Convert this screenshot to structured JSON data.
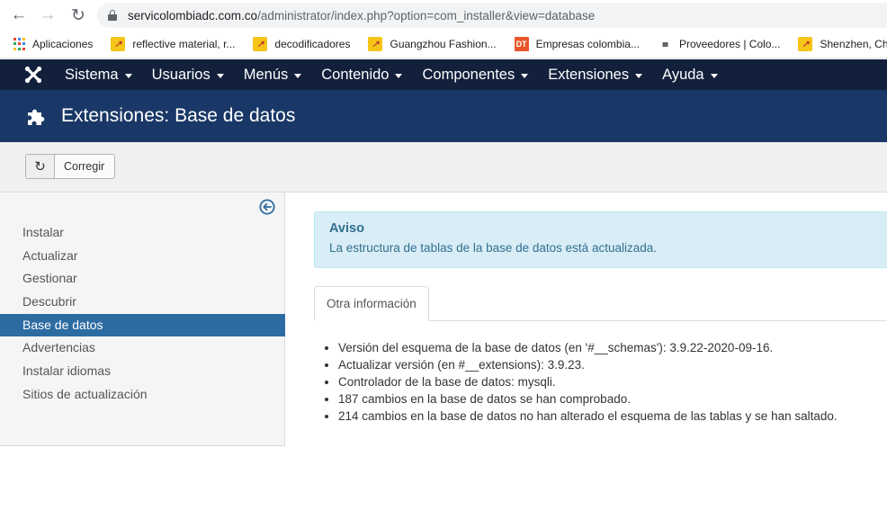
{
  "browser": {
    "url_host": "servicolombiadc.com.co",
    "url_path": "/administrator/index.php?option=com_installer&view=database",
    "bookmarks": [
      {
        "label": "Aplicaciones",
        "icon": "apps-grid-icon"
      },
      {
        "label": "reflective material, r...",
        "icon": "aliexpress-icon"
      },
      {
        "label": "decodificadores",
        "icon": "aliexpress-icon"
      },
      {
        "label": "Guangzhou Fashion...",
        "icon": "aliexpress-icon"
      },
      {
        "label": "Empresas colombia...",
        "icon": "dt-icon",
        "icon_text": "DT"
      },
      {
        "label": "Proveedores | Colo...",
        "icon": "proveedores-icon",
        "icon_text": "ıııı"
      },
      {
        "label": "Shenzhen, China N",
        "icon": "aliexpress-icon"
      }
    ]
  },
  "topnav": {
    "items": [
      {
        "label": "Sistema"
      },
      {
        "label": "Usuarios"
      },
      {
        "label": "Menús"
      },
      {
        "label": "Contenido"
      },
      {
        "label": "Componentes"
      },
      {
        "label": "Extensiones"
      },
      {
        "label": "Ayuda"
      }
    ],
    "background": "#12203b"
  },
  "header": {
    "title": "Extensiones: Base de datos",
    "background": "#1a3867",
    "icon": "puzzle-icon"
  },
  "toolbar": {
    "corregir_label": "Corregir",
    "corregir_icon": "refresh-icon"
  },
  "sidebar": {
    "items": [
      {
        "label": "Instalar"
      },
      {
        "label": "Actualizar"
      },
      {
        "label": "Gestionar"
      },
      {
        "label": "Descubrir"
      },
      {
        "label": "Base de datos",
        "active": true
      },
      {
        "label": "Advertencias"
      },
      {
        "label": "Instalar idiomas"
      },
      {
        "label": "Sitios de actualización"
      }
    ],
    "active_color": "#2d6ca2"
  },
  "alert": {
    "title": "Aviso",
    "message": "La estructura de tablas de la base de datos está actualizada."
  },
  "tabs": [
    {
      "label": "Otra información",
      "active": true
    }
  ],
  "info": [
    "Versión del esquema de la base de datos (en '#__schemas'): 3.9.22-2020-09-16.",
    "Actualizar versión (en #__extensions): 3.9.23.",
    "Controlador de la base de datos: mysqli.",
    "187 cambios en la base de datos se han comprobado.",
    "214 cambios en la base de datos no han alterado el esquema de las tablas y se han saltado."
  ]
}
